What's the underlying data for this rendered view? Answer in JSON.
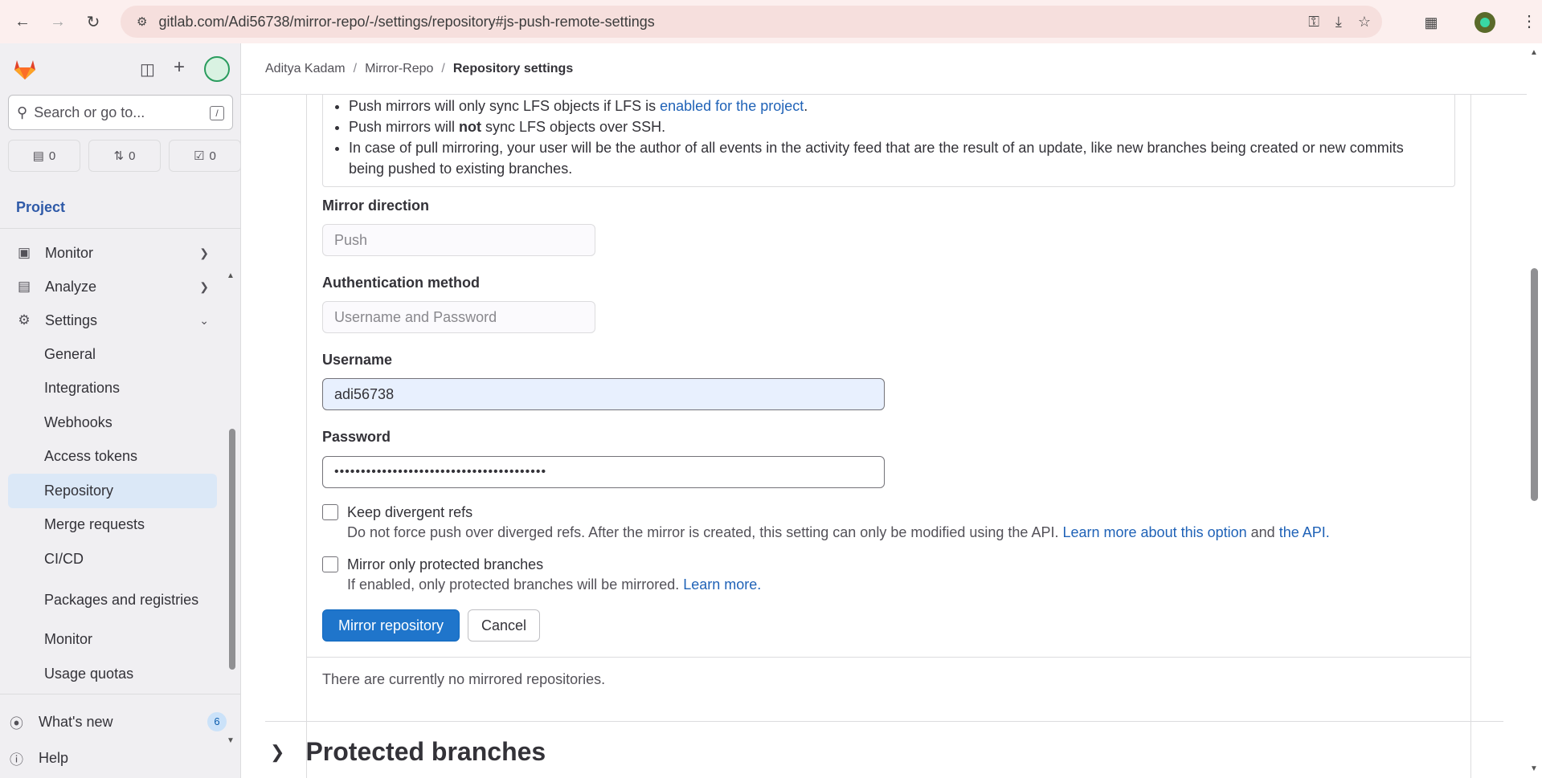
{
  "browser": {
    "url": "gitlab.com/Adi56738/mirror-repo/-/settings/repository#js-push-remote-settings"
  },
  "sidebar": {
    "search_placeholder": "Search or go to...",
    "search_shortcut": "/",
    "counters": {
      "issues": "0",
      "merge_requests": "0",
      "todos": "0"
    },
    "context_title": "Project",
    "nav": [
      {
        "label": "Monitor",
        "icon": "monitor-icon"
      },
      {
        "label": "Analyze",
        "icon": "chart-icon"
      },
      {
        "label": "Settings",
        "icon": "gear-icon"
      }
    ],
    "settings_items": [
      "General",
      "Integrations",
      "Webhooks",
      "Access tokens",
      "Repository",
      "Merge requests",
      "CI/CD",
      "Packages and registries",
      "Monitor",
      "Usage quotas"
    ],
    "whats_new": {
      "label": "What's new",
      "count": "6"
    },
    "help": "Help"
  },
  "breadcrumb": {
    "user": "Aditya Kadam",
    "project": "Mirror-Repo",
    "current": "Repository settings"
  },
  "info": {
    "line1_prefix": "Push mirrors will only sync LFS objects if LFS is ",
    "line1_link": "enabled for the project",
    "line1_suffix": ".",
    "line2_prefix": "Push mirrors will ",
    "line2_bold": "not",
    "line2_suffix": " sync LFS objects over SSH.",
    "line3": "In case of pull mirroring, your user will be the author of all events in the activity feed that are the result of an update, like new branches being created or new commits being pushed to existing branches."
  },
  "form": {
    "mirror_direction_label": "Mirror direction",
    "mirror_direction_value": "Push",
    "auth_method_label": "Authentication method",
    "auth_method_value": "Username and Password",
    "username_label": "Username",
    "username_value": "adi56738",
    "password_label": "Password",
    "password_value": "••••••••••••••••••••••••••••••••••••••••",
    "keep_divergent_label": "Keep divergent refs",
    "keep_divergent_help": "Do not force push over diverged refs. After the mirror is created, this setting can only be modified using the API.",
    "keep_divergent_link1": "Learn more about this option",
    "keep_divergent_and": "and",
    "keep_divergent_link2": "the API",
    "protected_only_label": "Mirror only protected branches",
    "protected_only_help": "If enabled, only protected branches will be mirrored.",
    "protected_only_link": "Learn more.",
    "submit_label": "Mirror repository",
    "cancel_label": "Cancel"
  },
  "mirrors_empty": "There are currently no mirrored repositories.",
  "next_section": "Protected branches"
}
